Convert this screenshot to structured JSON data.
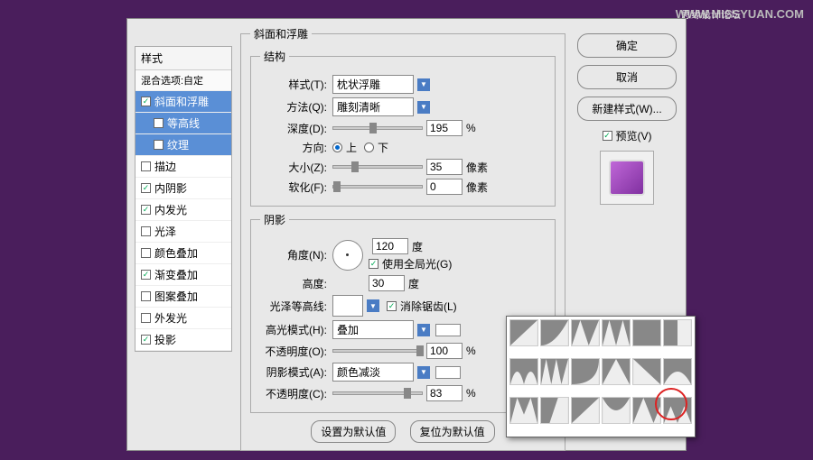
{
  "watermark": "WWW.MISSYUAN.COM",
  "watermark_cn": "思缘设计论坛",
  "styles_panel": {
    "header": "样式",
    "blend_options": "混合选项:自定",
    "items": [
      {
        "label": "斜面和浮雕",
        "checked": true,
        "selected": true
      },
      {
        "label": "等高线",
        "checked": false,
        "sub": true,
        "selected_bg": true
      },
      {
        "label": "纹理",
        "checked": false,
        "sub": true,
        "selected_bg": true
      },
      {
        "label": "描边",
        "checked": false
      },
      {
        "label": "内阴影",
        "checked": true
      },
      {
        "label": "内发光",
        "checked": true
      },
      {
        "label": "光泽",
        "checked": false
      },
      {
        "label": "颜色叠加",
        "checked": false
      },
      {
        "label": "渐变叠加",
        "checked": true
      },
      {
        "label": "图案叠加",
        "checked": false
      },
      {
        "label": "外发光",
        "checked": false
      },
      {
        "label": "投影",
        "checked": true
      }
    ]
  },
  "main": {
    "title": "斜面和浮雕",
    "structure_legend": "结构",
    "style_label": "样式(T):",
    "style_value": "枕状浮雕",
    "method_label": "方法(Q):",
    "method_value": "雕刻清晰",
    "depth_label": "深度(D):",
    "depth_value": "195",
    "depth_unit": "%",
    "direction_label": "方向:",
    "dir_up": "上",
    "dir_down": "下",
    "size_label": "大小(Z):",
    "size_value": "35",
    "size_unit": "像素",
    "soften_label": "软化(F):",
    "soften_value": "0",
    "soften_unit": "像素",
    "shading_legend": "阴影",
    "angle_label": "角度(N):",
    "angle_value": "120",
    "angle_unit": "度",
    "global_light": "使用全局光(G)",
    "altitude_label": "高度:",
    "altitude_value": "30",
    "altitude_unit": "度",
    "gloss_label": "光泽等高线:",
    "antialias": "消除锯齿(L)",
    "highlight_mode_label": "高光模式(H):",
    "highlight_mode_value": "叠加",
    "h_opacity_label": "不透明度(O):",
    "h_opacity_value": "100",
    "h_opacity_unit": "%",
    "shadow_mode_label": "阴影模式(A):",
    "shadow_mode_value": "颜色减淡",
    "s_opacity_label": "不透明度(C):",
    "s_opacity_value": "83",
    "s_opacity_unit": "%",
    "set_default": "设置为默认值",
    "reset_default": "复位为默认值"
  },
  "right": {
    "ok": "确定",
    "cancel": "取消",
    "new_style": "新建样式(W)...",
    "preview": "预览(V)"
  }
}
